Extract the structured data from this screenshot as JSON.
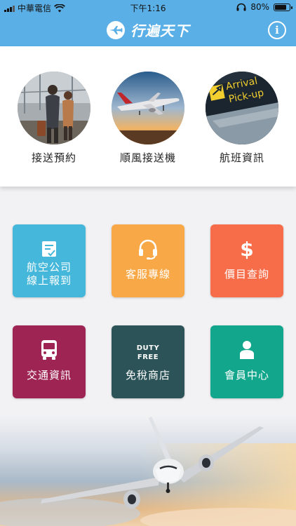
{
  "status": {
    "carrier": "中華電信",
    "time": "下午1:16",
    "battery": "80%"
  },
  "header": {
    "title": "行遍天下"
  },
  "top_items": [
    {
      "label": "接送預約"
    },
    {
      "label": "順風接送機"
    },
    {
      "label": "航班資訊"
    }
  ],
  "arrival_sign": {
    "line1": "Arrival",
    "line2": "Pick-up"
  },
  "tiles": [
    {
      "line1": "航空公司",
      "line2": "線上報到",
      "color": "#45b7da"
    },
    {
      "label": "客服專線",
      "color": "#f8a846"
    },
    {
      "label": "價目查詢",
      "color": "#f76d4a"
    },
    {
      "label": "交通資訊",
      "color": "#9e2453"
    },
    {
      "label": "免稅商店",
      "icon_text1": "DUTY",
      "icon_text2": "FREE",
      "color": "#2c5458"
    },
    {
      "label": "會員中心",
      "color": "#12a78c"
    }
  ]
}
